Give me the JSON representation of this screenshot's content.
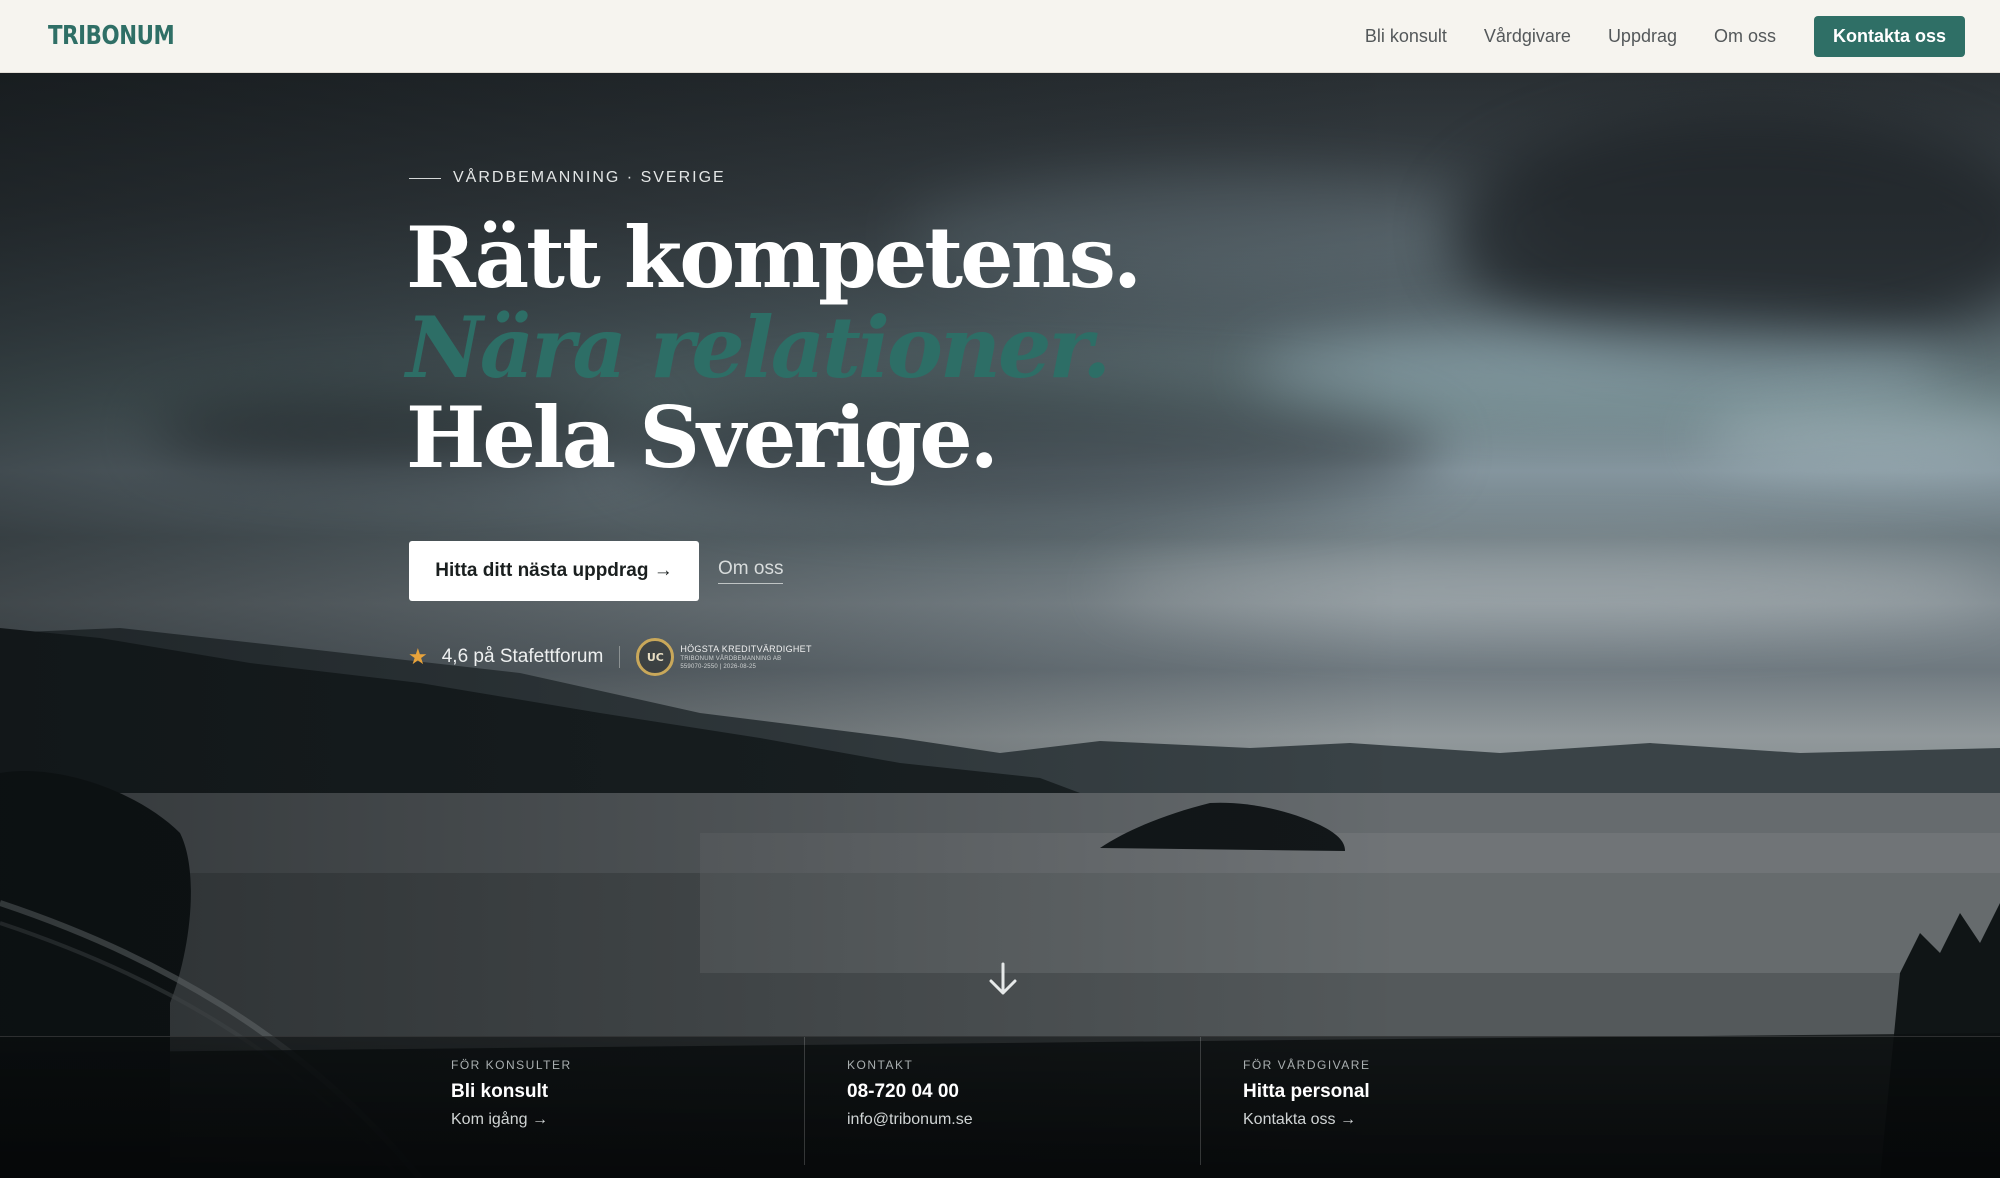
{
  "header": {
    "logo": "TRIBONUM",
    "nav": [
      "Bli konsult",
      "Vårdgivare",
      "Uppdrag",
      "Om oss"
    ],
    "cta_label": "Kontakta oss"
  },
  "hero": {
    "eyebrow": "VÅRDBEMANNING · SVERIGE",
    "headline": [
      "Rätt kompetens.",
      "Nära relationer.",
      "Hela Sverige."
    ],
    "primary_button": "Hitta ditt nästa uppdrag →",
    "secondary_link": "Om oss",
    "rating_text": "4,6 på Stafettforum",
    "uc_badge": {
      "seal": "UC",
      "title": "HÖGSTA KREDITVÄRDIGHET",
      "company": "TRIBONUM VÅRDBEMANNING AB",
      "details": "559070-2550 | 2026-08-25"
    }
  },
  "strip": [
    {
      "label": "FÖR KONSULTER",
      "title": "Bli konsult",
      "sub": "Kom igång →"
    },
    {
      "label": "KONTAKT",
      "title": "08-720 04 00",
      "sub": "info@tribonum.se"
    },
    {
      "label": "FÖR VÅRDGIVARE",
      "title": "Hitta personal",
      "sub": "Kontakta oss →"
    }
  ],
  "icons": {
    "rating": "star-icon",
    "scroll": "arrow-down-icon"
  },
  "colors": {
    "brand": "#2f6f66",
    "accent_text": "#2d6e66",
    "star": "#e8a33b",
    "header_bg": "#f6f4ef"
  }
}
